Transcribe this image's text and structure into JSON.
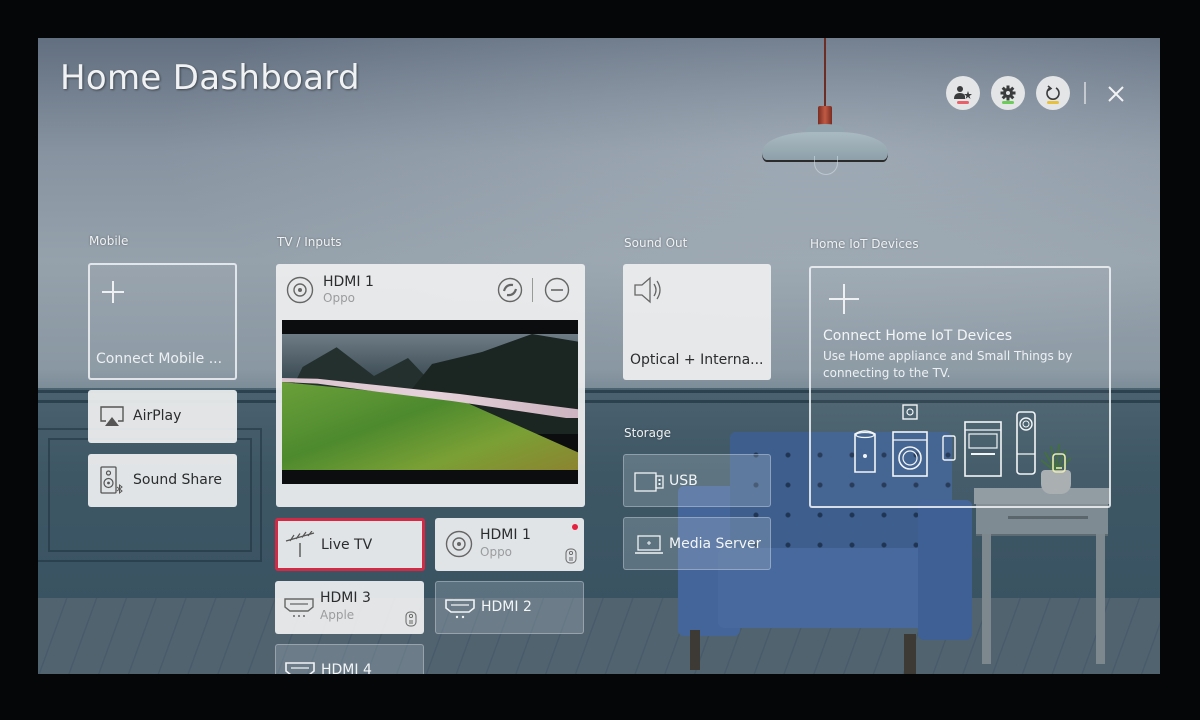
{
  "header": {
    "title": "Home Dashboard",
    "buttons": [
      {
        "name": "user-profile-button",
        "icon": "user-star-icon",
        "indicator_color": "#e8606a"
      },
      {
        "name": "settings-button",
        "icon": "gear-icon",
        "indicator_color": "#6ccc5a"
      },
      {
        "name": "refresh-button",
        "icon": "refresh-icon",
        "indicator_color": "#e8c040"
      }
    ],
    "close_icon": "close-icon"
  },
  "sections": {
    "mobile": {
      "label": "Mobile",
      "connect_card": {
        "icon": "plus-icon",
        "label": "Connect Mobile ..."
      },
      "items": [
        {
          "icon": "airplay-icon",
          "label": "AirPlay"
        },
        {
          "icon": "speaker-bluetooth-icon",
          "label": "Sound Share"
        }
      ]
    },
    "tv_inputs": {
      "label": "TV / Inputs",
      "current": {
        "icon": "disc-input-icon",
        "name": "HDMI 1",
        "device": "Oppo",
        "actions": [
          {
            "name": "sync-action",
            "icon": "sync-icon"
          },
          {
            "name": "remove-action",
            "icon": "minus-circle-icon"
          }
        ]
      },
      "inputs": [
        {
          "icon": "antenna-icon",
          "name": "Live TV",
          "device": "",
          "focused": true
        },
        {
          "icon": "disc-input-icon",
          "name": "HDMI 1",
          "device": "Oppo",
          "status_dot_color": "#e5213f",
          "badge_icon": "remote-icon"
        },
        {
          "icon": "hdmi-port-icon",
          "name": "HDMI 3",
          "device": "Apple",
          "badge_icon": "remote-icon"
        },
        {
          "icon": "hdmi-port-icon",
          "name": "HDMI 2",
          "device": ""
        },
        {
          "icon": "hdmi-port-icon",
          "name": "HDMI 4",
          "device": ""
        }
      ]
    },
    "sound_out": {
      "label": "Sound Out",
      "card": {
        "icon": "speaker-icon",
        "label": "Optical + Interna..."
      }
    },
    "storage": {
      "label": "Storage",
      "items": [
        {
          "icon": "usb-icon",
          "label": "USB"
        },
        {
          "icon": "laptop-icon",
          "label": "Media Server"
        }
      ]
    },
    "iot": {
      "label": "Home IoT Devices",
      "card": {
        "icon": "plus-icon",
        "title": "Connect Home IoT Devices",
        "description": "Use Home appliance and Small Things by connecting to the TV.",
        "appliance_icons": [
          "air-purifier-icon",
          "washing-machine-icon",
          "smart-plug-icon",
          "phone-icon",
          "oven-icon",
          "smart-speaker-icon",
          "sensor-icon"
        ]
      }
    }
  },
  "colors": {
    "focus_border": "#d22a45",
    "status_dot": "#e5213f"
  }
}
